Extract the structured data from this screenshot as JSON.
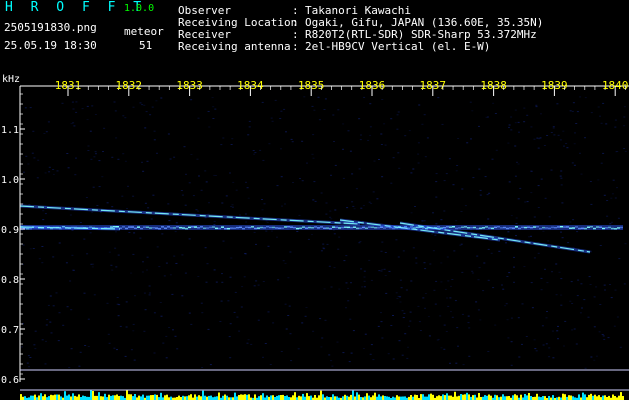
{
  "header": {
    "app_name": "H R O F F T",
    "version": "1.0.0",
    "file_name": "2505191830.png",
    "meteor_label": "meteor",
    "date_time": "25.05.19 18:30",
    "meteor_count": "51"
  },
  "metadata": [
    {
      "label": "Observer",
      "value": "Takanori Kawachi"
    },
    {
      "label": "Receiving Location",
      "value": "Ogaki, Gifu, JAPAN (136.60E, 35.35N)"
    },
    {
      "label": "Receiver",
      "value": "R820T2(RTL-SDR) SDR-Sharp 53.372MHz"
    },
    {
      "label": "Receiving antenna",
      "value": "2el-HB9CV Vertical (el. E-W)"
    }
  ],
  "colors": {
    "header_cyan": "#00ffff",
    "header_white": "#ffffff",
    "header_green": "#00ff00",
    "tick_yellow": "#ffff00",
    "background": "#000000",
    "noise_blue": "#0f1f6e",
    "signal_cyan": "#7fffff",
    "meteor_bar_yellow": "#ffff00",
    "meteor_bar_cyan": "#00e0ff"
  },
  "spectrogram": {
    "y_unit": "kHz",
    "y_ticks": [
      "1.1",
      "1.0",
      "0.9",
      "0.8",
      "0.7",
      "0.6"
    ],
    "x_ticks": [
      "1831",
      "1832",
      "1833",
      "1834",
      "1835",
      "1836",
      "1837",
      "1838",
      "1839",
      "1840"
    ]
  }
}
